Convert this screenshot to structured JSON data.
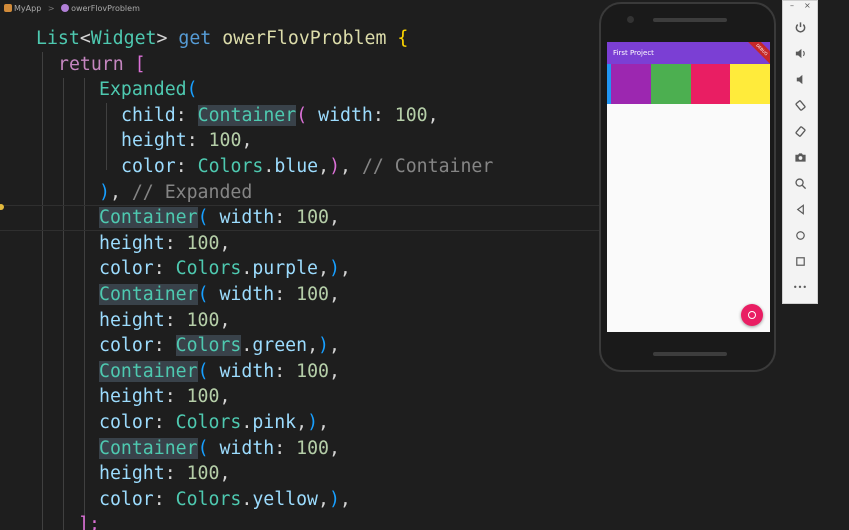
{
  "breadcrumb": {
    "items": [
      "MyApp",
      "owerFlovProblem"
    ],
    "separator": ">"
  },
  "code": {
    "l1": {
      "type": "List",
      "generic": "Widget",
      "kw": "get",
      "name": "owerFlovProblem",
      "brace": "{"
    },
    "l2": {
      "kw": "return",
      "bracket": "["
    },
    "l3": {
      "widget": "Expanded",
      "paren": "("
    },
    "l4": {
      "prop": "child",
      "widget": "Container",
      "paren": "(",
      "prop2": "width",
      "value": "100"
    },
    "l5": {
      "prop": "height",
      "value": "100"
    },
    "l6": {
      "prop": "color",
      "cls": "Colors",
      "member": "blue",
      "comment": "// Container"
    },
    "l7": {
      "comment": "// Expanded"
    },
    "blocks": [
      {
        "widget": "Container",
        "width_prop": "width",
        "width": "100",
        "height_prop": "height",
        "height": "100",
        "color_prop": "color",
        "cls": "Colors",
        "member": "purple"
      },
      {
        "widget": "Container",
        "width_prop": "width",
        "width": "100",
        "height_prop": "height",
        "height": "100",
        "color_prop": "color",
        "cls": "Colors",
        "member": "green"
      },
      {
        "widget": "Container",
        "width_prop": "width",
        "width": "100",
        "height_prop": "height",
        "height": "100",
        "color_prop": "color",
        "cls": "Colors",
        "member": "pink"
      },
      {
        "widget": "Container",
        "width_prop": "width",
        "width": "100",
        "height_prop": "height",
        "height": "100",
        "color_prop": "color",
        "cls": "Colors",
        "member": "yellow"
      }
    ],
    "closing": "];"
  },
  "emulator": {
    "app_title": "First Project",
    "debug_banner": "DEBUG",
    "colors": {
      "blue": "#2196f3",
      "purple": "#9c27b0",
      "green": "#4caf50",
      "pink": "#e91e63",
      "yellow": "#ffeb3b",
      "appbar": "#7b3fd4"
    },
    "fab_icon": "add-circle-icon"
  },
  "toolbar": {
    "window_controls": [
      "–",
      "×"
    ],
    "tools": [
      "power-icon",
      "volume-up-icon",
      "volume-down-icon",
      "rotate-left-icon",
      "rotate-right-icon",
      "camera-icon",
      "zoom-icon",
      "back-icon",
      "home-icon",
      "overview-icon",
      "more-icon"
    ],
    "more_label": "•••"
  }
}
